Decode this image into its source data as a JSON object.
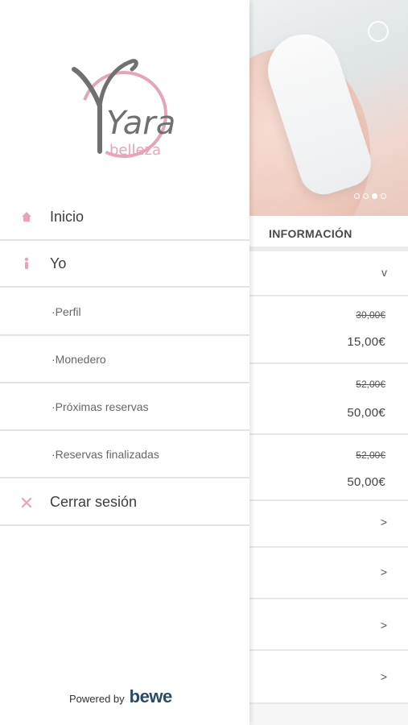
{
  "drawer": {
    "logo": {
      "name": "Yara",
      "sub": "belleza"
    },
    "menu": [
      {
        "label": "Inicio",
        "icon": "home-icon"
      },
      {
        "label": "Yo",
        "icon": "person-icon"
      },
      {
        "label": "·Perfil",
        "sub": true
      },
      {
        "label": "·Monedero",
        "sub": true
      },
      {
        "label": "·Próximas reservas",
        "sub": true
      },
      {
        "label": "·Reservas finalizadas",
        "sub": true
      },
      {
        "label": "Cerrar sesión",
        "icon": "close-icon"
      }
    ],
    "powered_by": "Powered by",
    "brand": "bewe"
  },
  "page": {
    "hero_dots": 4,
    "hero_active_dot": 2,
    "section_title": "INFORMACIÓN",
    "rows": [
      {
        "chevron": "v"
      },
      {
        "old_price": "30,00€",
        "new_price": "15,00€"
      },
      {
        "old_price": "52,00€",
        "new_price": "50,00€"
      },
      {
        "old_price": "52,00€",
        "new_price": "50,00€"
      },
      {
        "chevron": ">"
      },
      {
        "chevron": ">"
      },
      {
        "chevron": ">"
      },
      {
        "chevron": ">"
      }
    ]
  },
  "colors": {
    "accent_pink": "#e8a3b8",
    "logo_gray": "#707070",
    "brand_blue": "#1fb5d1"
  }
}
